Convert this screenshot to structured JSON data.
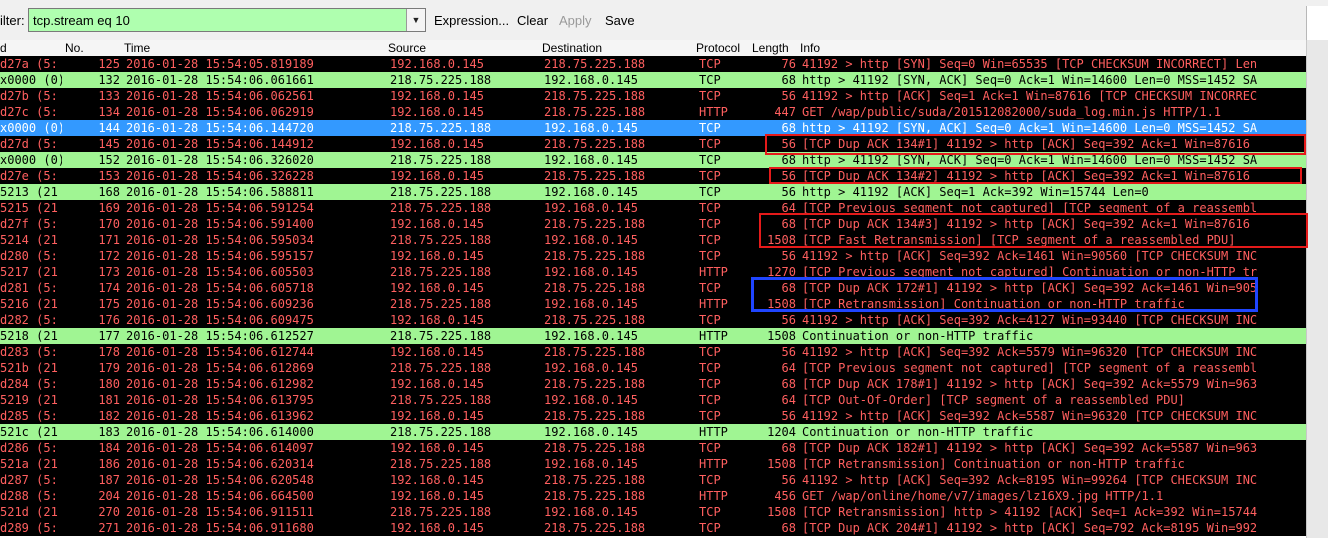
{
  "toolbar": {
    "filter_label": "ilter:",
    "filter_value": "tcp.stream eq 10",
    "expression_label": "Expression...",
    "clear_label": "Clear",
    "apply_label": "Apply",
    "save_label": "Save",
    "apply_enabled": false
  },
  "columns": [
    "d",
    "No.",
    "Time",
    "Source",
    "Destination",
    "Protocol",
    "Length",
    "Info"
  ],
  "colors": {
    "bad_bg": "#000000",
    "bad_fg": "#ff5f5f",
    "good_bg": "#a0f593",
    "selected_bg": "#3399ff",
    "filter_bg": "#afffaf",
    "annotation_red": "#e51a1a",
    "annotation_blue": "#1f45ff"
  },
  "packets": [
    {
      "id": "d27a (5:",
      "no": "125",
      "time": "2016-01-28 15:54:05.819189",
      "src": "192.168.0.145",
      "dst": "218.75.225.188",
      "proto": "TCP",
      "len": "76",
      "info": "41192 > http [SYN] Seq=0 Win=65535 [TCP CHECKSUM INCORRECT] Len",
      "style": "bad"
    },
    {
      "id": "x0000 (0)",
      "no": "132",
      "time": "2016-01-28 15:54:06.061661",
      "src": "218.75.225.188",
      "dst": "192.168.0.145",
      "proto": "TCP",
      "len": "68",
      "info": "http > 41192 [SYN, ACK] Seq=0 Ack=1 Win=14600 Len=0 MSS=1452 SA",
      "style": "good"
    },
    {
      "id": "d27b (5:",
      "no": "133",
      "time": "2016-01-28 15:54:06.062561",
      "src": "192.168.0.145",
      "dst": "218.75.225.188",
      "proto": "TCP",
      "len": "56",
      "info": "41192 > http [ACK] Seq=1 Ack=1 Win=87616 [TCP CHECKSUM INCORREC",
      "style": "bad"
    },
    {
      "id": "d27c (5:",
      "no": "134",
      "time": "2016-01-28 15:54:06.062919",
      "src": "192.168.0.145",
      "dst": "218.75.225.188",
      "proto": "HTTP",
      "len": "447",
      "info": "GET /wap/public/suda/201512082000/suda_log.min.js HTTP/1.1",
      "style": "bad"
    },
    {
      "id": "x0000 (0)",
      "no": "144",
      "time": "2016-01-28 15:54:06.144720",
      "src": "218.75.225.188",
      "dst": "192.168.0.145",
      "proto": "TCP",
      "len": "68",
      "info": "http > 41192 [SYN, ACK] Seq=0 Ack=1 Win=14600 Len=0 MSS=1452 SA",
      "style": "sel"
    },
    {
      "id": "d27d (5:",
      "no": "145",
      "time": "2016-01-28 15:54:06.144912",
      "src": "192.168.0.145",
      "dst": "218.75.225.188",
      "proto": "TCP",
      "len": "56",
      "info": "[TCP Dup ACK 134#1] 41192 > http [ACK] Seq=392 Ack=1 Win=87616",
      "style": "bad"
    },
    {
      "id": "x0000 (0)",
      "no": "152",
      "time": "2016-01-28 15:54:06.326020",
      "src": "218.75.225.188",
      "dst": "192.168.0.145",
      "proto": "TCP",
      "len": "68",
      "info": "http > 41192 [SYN, ACK] Seq=0 Ack=1 Win=14600 Len=0 MSS=1452 SA",
      "style": "good"
    },
    {
      "id": "d27e (5:",
      "no": "153",
      "time": "2016-01-28 15:54:06.326228",
      "src": "192.168.0.145",
      "dst": "218.75.225.188",
      "proto": "TCP",
      "len": "56",
      "info": "[TCP Dup ACK 134#2] 41192 > http [ACK] Seq=392 Ack=1 Win=87616",
      "style": "bad"
    },
    {
      "id": "5213 (21",
      "no": "168",
      "time": "2016-01-28 15:54:06.588811",
      "src": "218.75.225.188",
      "dst": "192.168.0.145",
      "proto": "TCP",
      "len": "56",
      "info": "http > 41192 [ACK] Seq=1 Ack=392 Win=15744 Len=0",
      "style": "good"
    },
    {
      "id": "5215 (21",
      "no": "169",
      "time": "2016-01-28 15:54:06.591254",
      "src": "218.75.225.188",
      "dst": "192.168.0.145",
      "proto": "TCP",
      "len": "64",
      "info": "[TCP Previous segment not captured] [TCP segment of a reassembl",
      "style": "bad"
    },
    {
      "id": "d27f (5:",
      "no": "170",
      "time": "2016-01-28 15:54:06.591400",
      "src": "192.168.0.145",
      "dst": "218.75.225.188",
      "proto": "TCP",
      "len": "68",
      "info": "[TCP Dup ACK 134#3] 41192 > http [ACK] Seq=392 Ack=1 Win=87616",
      "style": "bad"
    },
    {
      "id": "5214 (21",
      "no": "171",
      "time": "2016-01-28 15:54:06.595034",
      "src": "218.75.225.188",
      "dst": "192.168.0.145",
      "proto": "TCP",
      "len": "1508",
      "info": "[TCP Fast Retransmission] [TCP segment of a reassembled PDU]",
      "style": "bad"
    },
    {
      "id": "d280 (5:",
      "no": "172",
      "time": "2016-01-28 15:54:06.595157",
      "src": "192.168.0.145",
      "dst": "218.75.225.188",
      "proto": "TCP",
      "len": "56",
      "info": "41192 > http [ACK] Seq=392 Ack=1461 Win=90560 [TCP CHECKSUM INC",
      "style": "bad"
    },
    {
      "id": "5217 (21",
      "no": "173",
      "time": "2016-01-28 15:54:06.605503",
      "src": "218.75.225.188",
      "dst": "192.168.0.145",
      "proto": "HTTP",
      "len": "1270",
      "info": "[TCP Previous segment not captured] Continuation or non-HTTP tr",
      "style": "bad"
    },
    {
      "id": "d281 (5:",
      "no": "174",
      "time": "2016-01-28 15:54:06.605718",
      "src": "192.168.0.145",
      "dst": "218.75.225.188",
      "proto": "TCP",
      "len": "68",
      "info": "[TCP Dup ACK 172#1] 41192 > http [ACK] Seq=392 Ack=1461 Win=905",
      "style": "bad"
    },
    {
      "id": "5216 (21",
      "no": "175",
      "time": "2016-01-28 15:54:06.609236",
      "src": "218.75.225.188",
      "dst": "192.168.0.145",
      "proto": "HTTP",
      "len": "1508",
      "info": "[TCP Retransmission] Continuation or non-HTTP traffic",
      "style": "bad"
    },
    {
      "id": "d282 (5:",
      "no": "176",
      "time": "2016-01-28 15:54:06.609475",
      "src": "192.168.0.145",
      "dst": "218.75.225.188",
      "proto": "TCP",
      "len": "56",
      "info": "41192 > http [ACK] Seq=392 Ack=4127 Win=93440 [TCP CHECKSUM INC",
      "style": "bad"
    },
    {
      "id": "5218 (21",
      "no": "177",
      "time": "2016-01-28 15:54:06.612527",
      "src": "218.75.225.188",
      "dst": "192.168.0.145",
      "proto": "HTTP",
      "len": "1508",
      "info": "Continuation or non-HTTP traffic",
      "style": "good"
    },
    {
      "id": "d283 (5:",
      "no": "178",
      "time": "2016-01-28 15:54:06.612744",
      "src": "192.168.0.145",
      "dst": "218.75.225.188",
      "proto": "TCP",
      "len": "56",
      "info": "41192 > http [ACK] Seq=392 Ack=5579 Win=96320 [TCP CHECKSUM INC",
      "style": "bad"
    },
    {
      "id": "521b (21",
      "no": "179",
      "time": "2016-01-28 15:54:06.612869",
      "src": "218.75.225.188",
      "dst": "192.168.0.145",
      "proto": "TCP",
      "len": "64",
      "info": "[TCP Previous segment not captured] [TCP segment of a reassembl",
      "style": "bad"
    },
    {
      "id": "d284 (5:",
      "no": "180",
      "time": "2016-01-28 15:54:06.612982",
      "src": "192.168.0.145",
      "dst": "218.75.225.188",
      "proto": "TCP",
      "len": "68",
      "info": "[TCP Dup ACK 178#1] 41192 > http [ACK] Seq=392 Ack=5579 Win=963",
      "style": "bad"
    },
    {
      "id": "5219 (21",
      "no": "181",
      "time": "2016-01-28 15:54:06.613795",
      "src": "218.75.225.188",
      "dst": "192.168.0.145",
      "proto": "TCP",
      "len": "64",
      "info": "[TCP Out-Of-Order] [TCP segment of a reassembled PDU]",
      "style": "bad"
    },
    {
      "id": "d285 (5:",
      "no": "182",
      "time": "2016-01-28 15:54:06.613962",
      "src": "192.168.0.145",
      "dst": "218.75.225.188",
      "proto": "TCP",
      "len": "56",
      "info": "41192 > http [ACK] Seq=392 Ack=5587 Win=96320 [TCP CHECKSUM INC",
      "style": "bad"
    },
    {
      "id": "521c (21",
      "no": "183",
      "time": "2016-01-28 15:54:06.614000",
      "src": "218.75.225.188",
      "dst": "192.168.0.145",
      "proto": "HTTP",
      "len": "1204",
      "info": "Continuation or non-HTTP traffic",
      "style": "good"
    },
    {
      "id": "d286 (5:",
      "no": "184",
      "time": "2016-01-28 15:54:06.614097",
      "src": "192.168.0.145",
      "dst": "218.75.225.188",
      "proto": "TCP",
      "len": "68",
      "info": "[TCP Dup ACK 182#1] 41192 > http [ACK] Seq=392 Ack=5587 Win=963",
      "style": "bad"
    },
    {
      "id": "521a (21",
      "no": "186",
      "time": "2016-01-28 15:54:06.620314",
      "src": "218.75.225.188",
      "dst": "192.168.0.145",
      "proto": "HTTP",
      "len": "1508",
      "info": "[TCP Retransmission] Continuation or non-HTTP traffic",
      "style": "bad"
    },
    {
      "id": "d287 (5:",
      "no": "187",
      "time": "2016-01-28 15:54:06.620548",
      "src": "192.168.0.145",
      "dst": "218.75.225.188",
      "proto": "TCP",
      "len": "56",
      "info": "41192 > http [ACK] Seq=392 Ack=8195 Win=99264 [TCP CHECKSUM INC",
      "style": "bad"
    },
    {
      "id": "d288 (5:",
      "no": "204",
      "time": "2016-01-28 15:54:06.664500",
      "src": "192.168.0.145",
      "dst": "218.75.225.188",
      "proto": "HTTP",
      "len": "456",
      "info": "GET /wap/online/home/v7/images/lz16X9.jpg HTTP/1.1",
      "style": "bad"
    },
    {
      "id": "521d (21",
      "no": "270",
      "time": "2016-01-28 15:54:06.911511",
      "src": "218.75.225.188",
      "dst": "192.168.0.145",
      "proto": "TCP",
      "len": "1508",
      "info": "[TCP Retransmission] http > 41192 [ACK] Seq=1 Ack=392 Win=15744",
      "style": "bad"
    },
    {
      "id": "d289 (5:",
      "no": "271",
      "time": "2016-01-28 15:54:06.911680",
      "src": "192.168.0.145",
      "dst": "218.75.225.188",
      "proto": "TCP",
      "len": "68",
      "info": "[TCP Dup ACK 204#1] 41192 > http [ACK] Seq=792 Ack=8195 Win=992",
      "style": "bad"
    }
  ]
}
